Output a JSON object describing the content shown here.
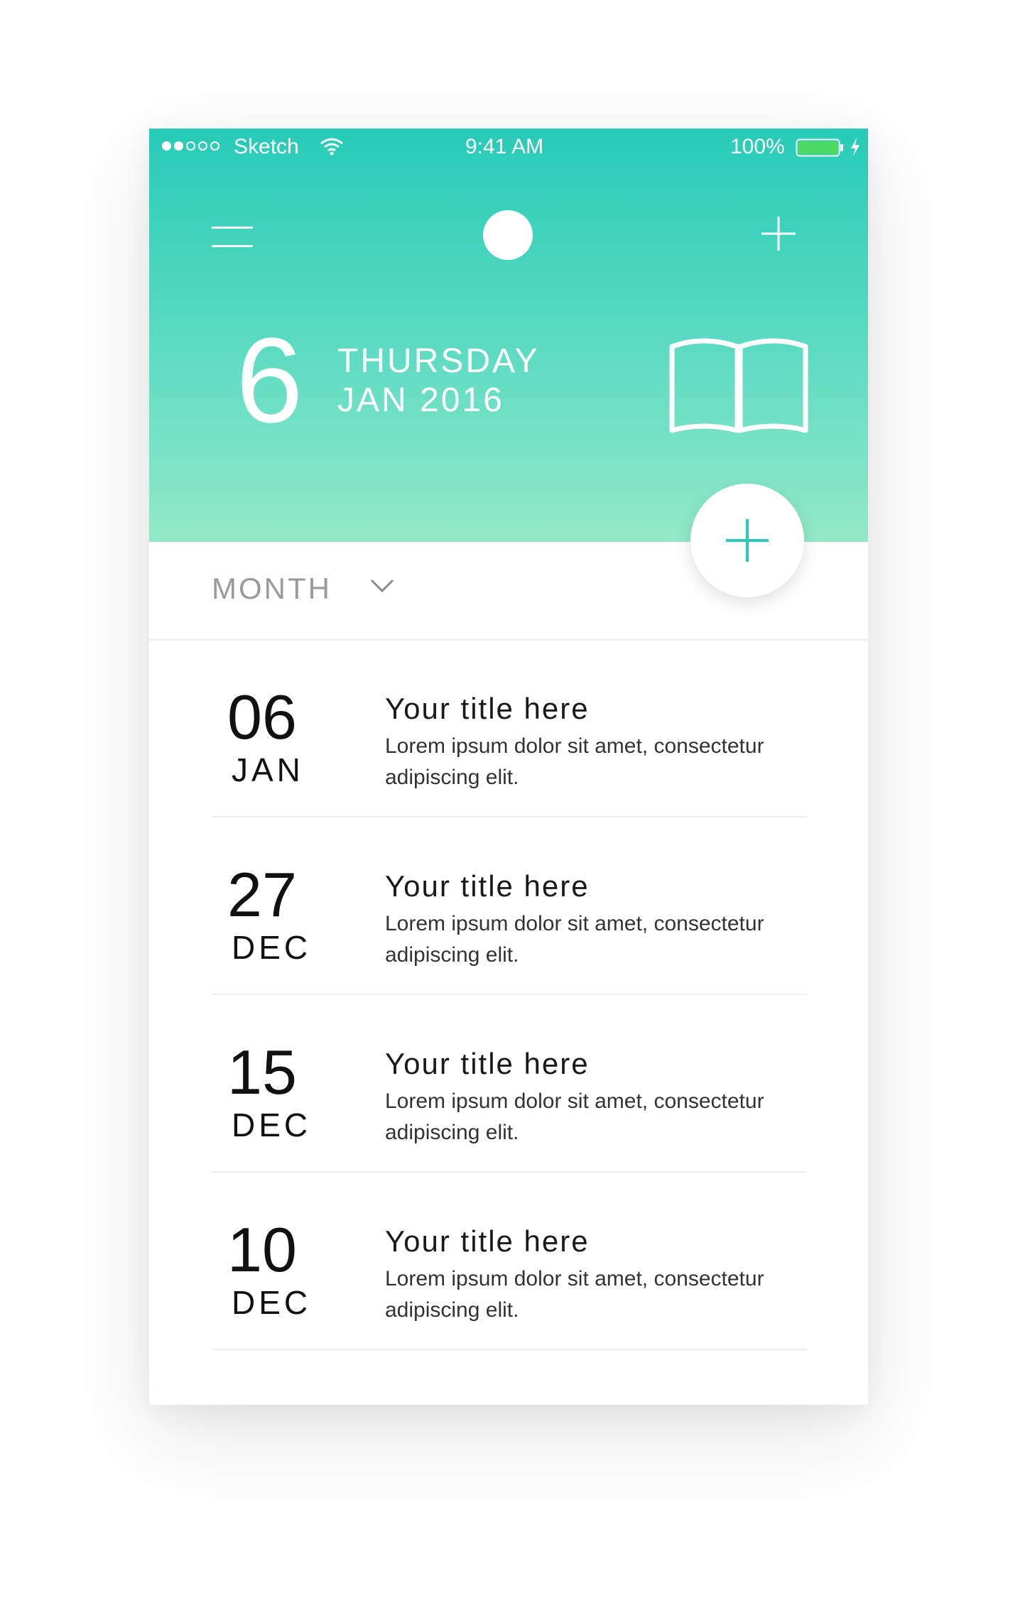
{
  "status_bar": {
    "carrier": "Sketch",
    "time": "9:41 AM",
    "battery": "100%",
    "battery_color": "#4cd964"
  },
  "header": {
    "day_number": "6",
    "weekday": "THURSDAY",
    "month_year": "JAN 2016",
    "icons": [
      "hamburger-menu-icon",
      "profile-avatar",
      "plus-icon",
      "book-icon"
    ],
    "gradient_top": "#27cbb7",
    "gradient_bottom": "#93e9c8"
  },
  "fab": {
    "icon": "plus-icon",
    "accent": "#27cbb7"
  },
  "filter": {
    "label": "MONTH",
    "icon": "chevron-down-icon"
  },
  "entries": [
    {
      "day": "06",
      "month": "JAN",
      "title": "Your title here",
      "description": "Lorem ipsum dolor sit amet, consectetur adipiscing elit."
    },
    {
      "day": "27",
      "month": "DEC",
      "title": "Your title here",
      "description": "Lorem ipsum dolor sit amet, consectetur adipiscing elit."
    },
    {
      "day": "15",
      "month": "DEC",
      "title": "Your title here",
      "description": "Lorem ipsum dolor sit amet, consectetur adipiscing elit."
    },
    {
      "day": "10",
      "month": "DEC",
      "title": "Your title here",
      "description": "Lorem ipsum dolor sit amet, consectetur adipiscing elit."
    }
  ]
}
